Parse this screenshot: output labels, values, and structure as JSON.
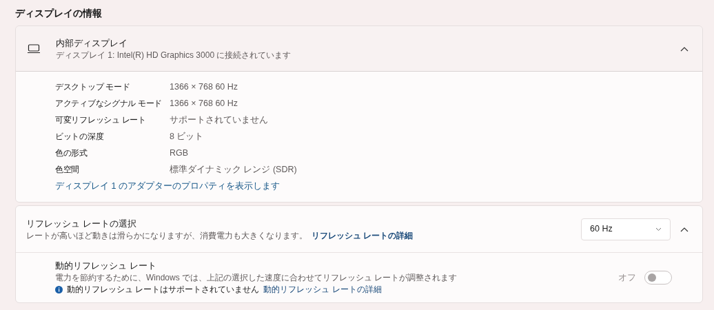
{
  "section_title": "ディスプレイの情報",
  "display_card": {
    "title": "内部ディスプレイ",
    "subtitle": "ディスプレイ 1: Intel(R) HD Graphics 3000 に接続されています",
    "expanded": true,
    "properties": [
      {
        "label": "デスクトップ モード",
        "value": "1366 × 768 60 Hz"
      },
      {
        "label": "アクティブなシグナル モード",
        "value": "1366 × 768 60 Hz"
      },
      {
        "label": "可変リフレッシュ レート",
        "value": "サポートされていません"
      },
      {
        "label": "ビットの深度",
        "value": "8 ビット"
      },
      {
        "label": "色の形式",
        "value": "RGB"
      },
      {
        "label": "色空間",
        "value": "標準ダイナミック レンジ (SDR)"
      }
    ],
    "link": "ディスプレイ 1 のアダプターのプロパティを表示します"
  },
  "refresh_card": {
    "title": "リフレッシュ レートの選択",
    "description": "レートが高いほど動きは滑らかになりますが、消費電力も大きくなります。",
    "link": "リフレッシュ レートの詳細",
    "dropdown_value": "60 Hz",
    "expanded": true,
    "dynamic": {
      "title": "動的リフレッシュ レート",
      "description": "電力を節約するために、Windows では、上記の選択した速度に合わせてリフレッシュ レートが調整されます",
      "info": "動的リフレッシュ レートはサポートされていません",
      "info_link": "動的リフレッシュ レートの詳細",
      "toggle_label": "オフ",
      "on": false
    }
  }
}
